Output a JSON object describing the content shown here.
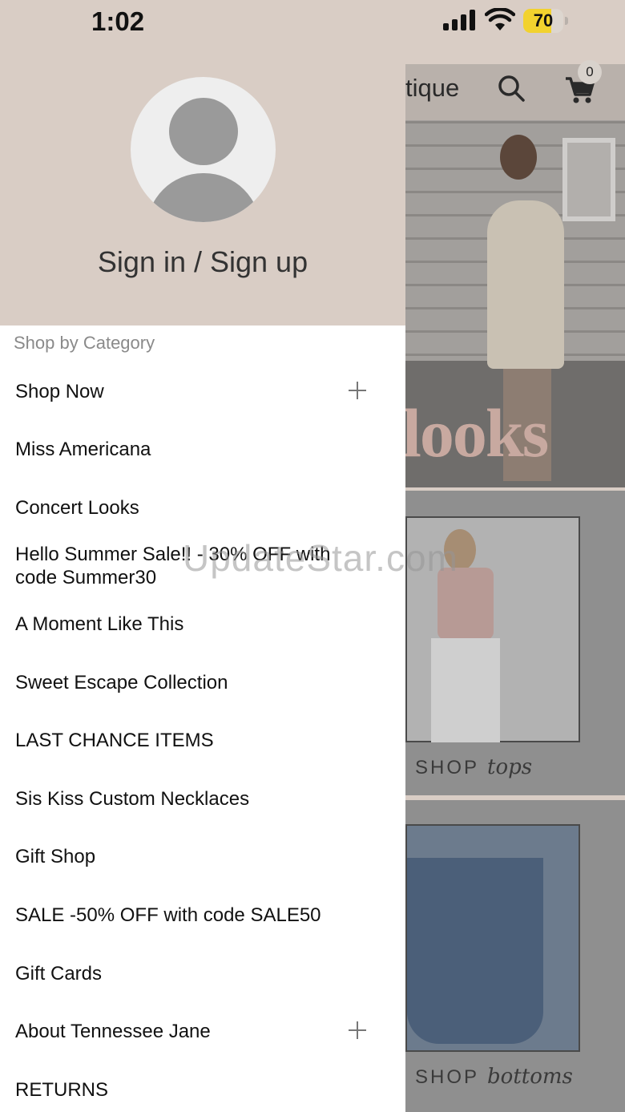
{
  "status_bar": {
    "time": "1:02",
    "battery_level": 70,
    "battery_color": "#f2d22e"
  },
  "drawer": {
    "header_bg": "#d9cdc5",
    "avatar_icon": "user-placeholder-icon",
    "signin_label": "Sign in / Sign up",
    "section_label": "Shop by Category",
    "items": [
      {
        "label": "Shop Now",
        "expandable": true
      },
      {
        "label": "Miss Americana",
        "expandable": false
      },
      {
        "label": "Concert Looks",
        "expandable": false
      },
      {
        "label": "Hello Summer Sale!! - 30% OFF with code Summer30",
        "expandable": false
      },
      {
        "label": "A Moment Like This",
        "expandable": false
      },
      {
        "label": "Sweet Escape Collection",
        "expandable": false
      },
      {
        "label": "LAST CHANCE ITEMS",
        "expandable": false
      },
      {
        "label": "Sis Kiss Custom Necklaces",
        "expandable": false
      },
      {
        "label": "Gift Shop",
        "expandable": false
      },
      {
        "label": "SALE -50% OFF with code SALE50",
        "expandable": false
      },
      {
        "label": "Gift Cards",
        "expandable": false
      },
      {
        "label": "About Tennessee Jane",
        "expandable": true
      },
      {
        "label": "RETURNS",
        "expandable": false
      }
    ]
  },
  "store": {
    "title_fragment": "tique",
    "search_icon": "search-icon",
    "cart_icon": "cart-icon",
    "cart_count": "0",
    "hero_word": "looks",
    "cards": [
      {
        "label": "SHOP",
        "script": "tops"
      },
      {
        "label": "SHOP",
        "script": "bottoms"
      }
    ]
  },
  "watermark": "UpdateStar.com"
}
